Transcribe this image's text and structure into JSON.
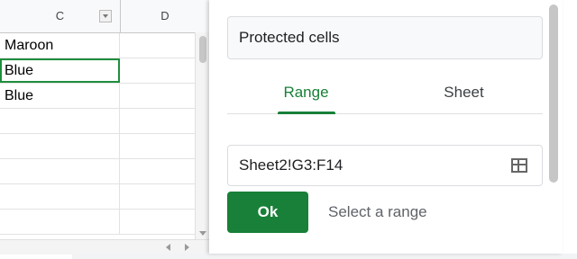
{
  "sheet": {
    "columns": [
      "C",
      "D"
    ],
    "rows": [
      {
        "c": "Maroon",
        "d": ""
      },
      {
        "c": "Blue",
        "d": ""
      },
      {
        "c": "Blue",
        "d": ""
      },
      {
        "c": "",
        "d": ""
      },
      {
        "c": "",
        "d": ""
      },
      {
        "c": "",
        "d": ""
      },
      {
        "c": "",
        "d": ""
      },
      {
        "c": "",
        "d": ""
      }
    ],
    "selected_row": 1
  },
  "panel": {
    "description": "Protected cells",
    "tabs": [
      {
        "label": "Range",
        "active": true
      },
      {
        "label": "Sheet",
        "active": false
      }
    ],
    "range_value": "Sheet2!G3:F14",
    "ok_label": "Ok",
    "hint": "Select a range",
    "accent_color": "#188038"
  }
}
